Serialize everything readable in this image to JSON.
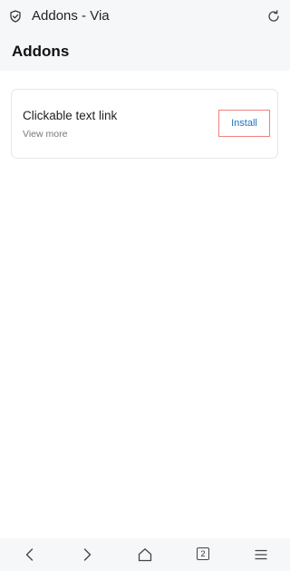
{
  "topbar": {
    "title": "Addons - Via",
    "left_icon": "shield-check-icon",
    "right_icon": "reload-icon"
  },
  "header": {
    "title": "Addons"
  },
  "addon": {
    "title": "Clickable text link",
    "more_label": "View more",
    "install_label": "Install"
  },
  "bottom_nav": {
    "tabs_count": "2",
    "icons": [
      "back-icon",
      "forward-icon",
      "home-icon",
      "tabs-icon",
      "menu-icon"
    ]
  },
  "colors": {
    "bar_background": "#f6f7f9",
    "link_blue": "#1a73c8",
    "highlight_border": "#f08080"
  }
}
